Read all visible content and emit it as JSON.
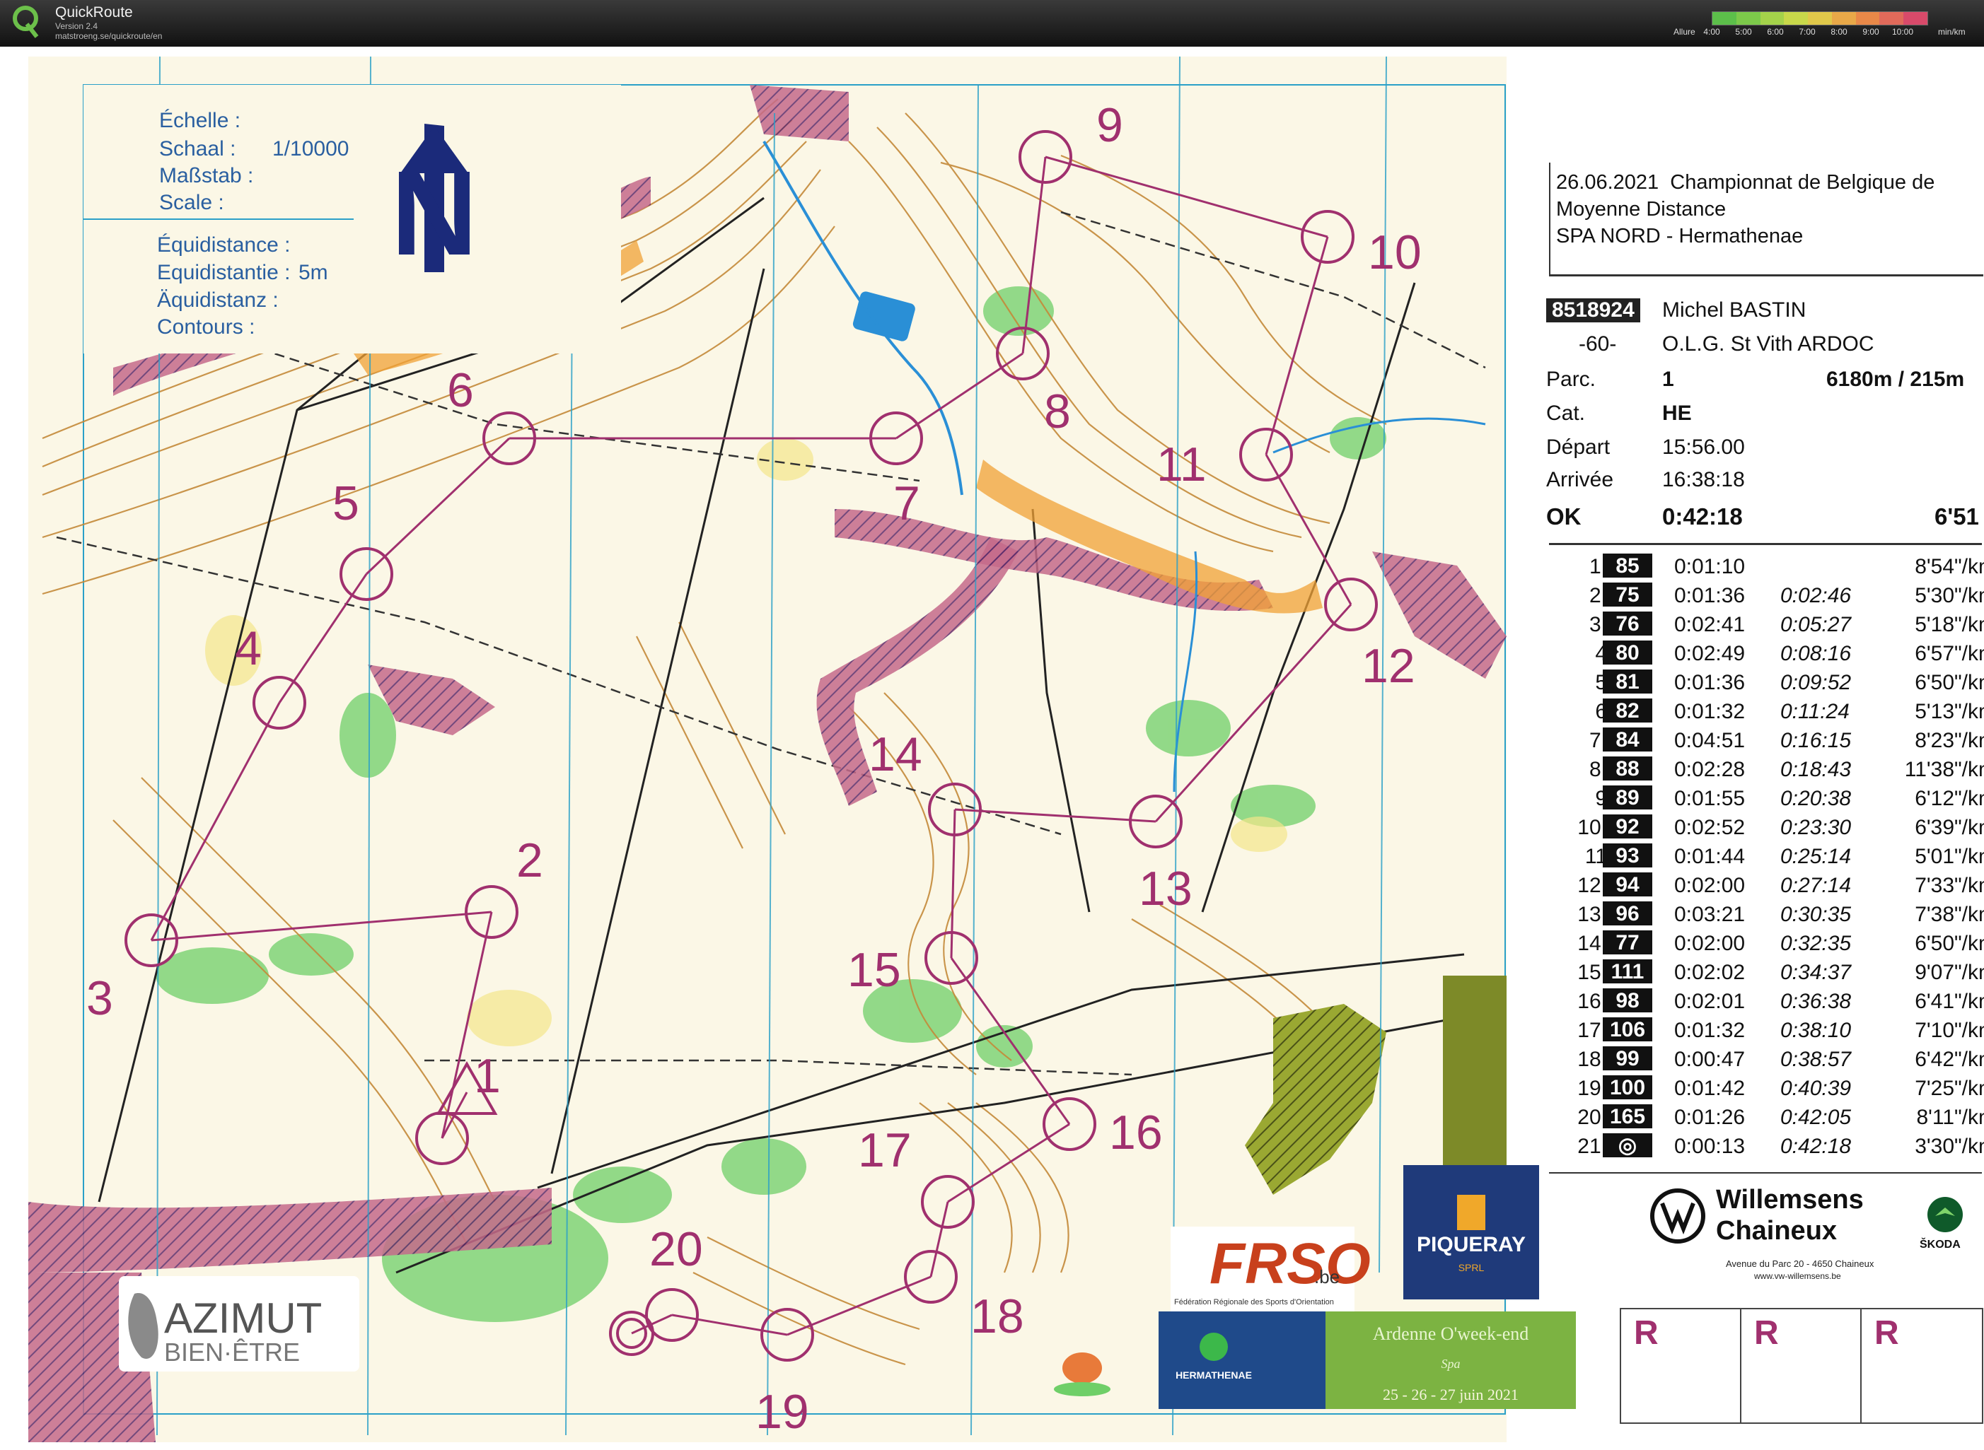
{
  "app": {
    "name": "QuickRoute",
    "version": "Version 2.4",
    "url": "matstroeng.se/quickroute/en",
    "legend": {
      "label": "Allure",
      "ticks": [
        "4:00",
        "5:00",
        "6:00",
        "7:00",
        "8:00",
        "9:00",
        "10:00"
      ],
      "unit": "min/km",
      "colors": [
        "#5cbf4a",
        "#7cc94a",
        "#a4d24a",
        "#c8d84a",
        "#e0c84a",
        "#e8a848",
        "#e88848",
        "#e06a5a",
        "#d84a6a"
      ]
    }
  },
  "map": {
    "scale_labels": [
      "Échelle :",
      "Schaal :",
      "Maßstab :",
      "Scale :"
    ],
    "scale_value": "1/10000",
    "equidistance_labels": [
      "Équidistance :",
      "Equidistantie :",
      "Äquidistanz :",
      "Contours :"
    ],
    "equidistance_value": "5m",
    "north_letter": "N",
    "controls": [
      {
        "label": "1"
      },
      {
        "label": "2"
      },
      {
        "label": "3"
      },
      {
        "label": "4"
      },
      {
        "label": "5"
      },
      {
        "label": "6"
      },
      {
        "label": "7"
      },
      {
        "label": "8"
      },
      {
        "label": "9"
      },
      {
        "label": "10"
      },
      {
        "label": "11"
      },
      {
        "label": "12"
      },
      {
        "label": "13"
      },
      {
        "label": "14"
      },
      {
        "label": "15"
      },
      {
        "label": "16"
      },
      {
        "label": "17"
      },
      {
        "label": "18"
      },
      {
        "label": "19"
      },
      {
        "label": "20"
      }
    ],
    "colors": {
      "course": "#a0306e",
      "contour": "#b7772a",
      "water": "#2a8fd6",
      "forest_green": "#3cb84a",
      "paper": "#fdfdf6"
    }
  },
  "results": {
    "date": "26.06.2021",
    "event_line1": "Championnat de Belgique de",
    "event_line2": "Moyenne Distance",
    "event_line3": "SPA NORD - Hermathenae",
    "bib": "8518924",
    "runner": "Michel BASTIN",
    "age_class": "-60-",
    "club": "O.L.G. St  Vith ARDOC",
    "course_label": "Parc.",
    "course_value": "1",
    "course_length": "6180m / 215m",
    "cat_label": "Cat.",
    "cat_value": "HE",
    "start_label": "Départ",
    "start_value": "15:56.00",
    "finish_label": "Arrivée",
    "finish_value": "16:38:18",
    "status_label": "OK",
    "total_time": "0:42:18",
    "avg_pace": "6'51",
    "splits": [
      {
        "n": "1.",
        "code": "85",
        "leg": "0:01:10",
        "cum": "",
        "pace": "8'54\"/km"
      },
      {
        "n": "2.",
        "code": "75",
        "leg": "0:01:36",
        "cum": "0:02:46",
        "pace": "5'30\"/km"
      },
      {
        "n": "3.",
        "code": "76",
        "leg": "0:02:41",
        "cum": "0:05:27",
        "pace": "5'18\"/km"
      },
      {
        "n": "4",
        "code": "80",
        "leg": "0:02:49",
        "cum": "0:08:16",
        "pace": "6'57\"/km"
      },
      {
        "n": "5",
        "code": "81",
        "leg": "0:01:36",
        "cum": "0:09:52",
        "pace": "6'50\"/km"
      },
      {
        "n": "6",
        "code": "82",
        "leg": "0:01:32",
        "cum": "0:11:24",
        "pace": "5'13\"/km"
      },
      {
        "n": "7.",
        "code": "84",
        "leg": "0:04:51",
        "cum": "0:16:15",
        "pace": "8'23\"/km"
      },
      {
        "n": "8.",
        "code": "88",
        "leg": "0:02:28",
        "cum": "0:18:43",
        "pace": "11'38\"/km"
      },
      {
        "n": "9",
        "code": "89",
        "leg": "0:01:55",
        "cum": "0:20:38",
        "pace": "6'12\"/km"
      },
      {
        "n": "10.",
        "code": "92",
        "leg": "0:02:52",
        "cum": "0:23:30",
        "pace": "6'39\"/km"
      },
      {
        "n": "11",
        "code": "93",
        "leg": "0:01:44",
        "cum": "0:25:14",
        "pace": "5'01\"/km"
      },
      {
        "n": "12.",
        "code": "94",
        "leg": "0:02:00",
        "cum": "0:27:14",
        "pace": "7'33\"/km"
      },
      {
        "n": "13.",
        "code": "96",
        "leg": "0:03:21",
        "cum": "0:30:35",
        "pace": "7'38\"/km"
      },
      {
        "n": "14.",
        "code": "77",
        "leg": "0:02:00",
        "cum": "0:32:35",
        "pace": "6'50\"/km"
      },
      {
        "n": "15.",
        "code": "111",
        "leg": "0:02:02",
        "cum": "0:34:37",
        "pace": "9'07\"/km"
      },
      {
        "n": "16.",
        "code": "98",
        "leg": "0:02:01",
        "cum": "0:36:38",
        "pace": "6'41\"/km"
      },
      {
        "n": "17.",
        "code": "106",
        "leg": "0:01:32",
        "cum": "0:38:10",
        "pace": "7'10\"/km"
      },
      {
        "n": "18.",
        "code": "99",
        "leg": "0:00:47",
        "cum": "0:38:57",
        "pace": "6'42\"/km"
      },
      {
        "n": "19.",
        "code": "100",
        "leg": "0:01:42",
        "cum": "0:40:39",
        "pace": "7'25\"/km"
      },
      {
        "n": "20.",
        "code": "165",
        "leg": "0:01:26",
        "cum": "0:42:05",
        "pace": "8'11\"/km"
      },
      {
        "n": "21.",
        "code": "◎",
        "leg": "0:00:13",
        "cum": "0:42:18",
        "pace": "3'30\"/km"
      }
    ]
  },
  "sponsors": {
    "willemsens_line1": "Willemsens",
    "willemsens_line2": "Chaineux",
    "willemsens_addr": "Avenue du Parc 20 - 4650 Chaineux",
    "willemsens_web": "www.vw-willemsens.be",
    "skoda": "ŠKODA",
    "piqueray": "PIQUERAY",
    "piqueray_sub": "SPRL",
    "frso": "FRSO",
    "frso_tld": ".be",
    "frso_sub": "Fédération Régionale des Sports d'Orientation",
    "hermathenae": "HERMATHENAE",
    "ardenne_title": "Ardenne O'week-end",
    "ardenne_city": "Spa",
    "ardenne_dates": "25 - 26 - 27 juin 2021",
    "azimut_line1": "AZIMUT",
    "azimut_line2": "BIEN·ÊTRE",
    "r_boxes": [
      "R",
      "R",
      "R"
    ]
  }
}
